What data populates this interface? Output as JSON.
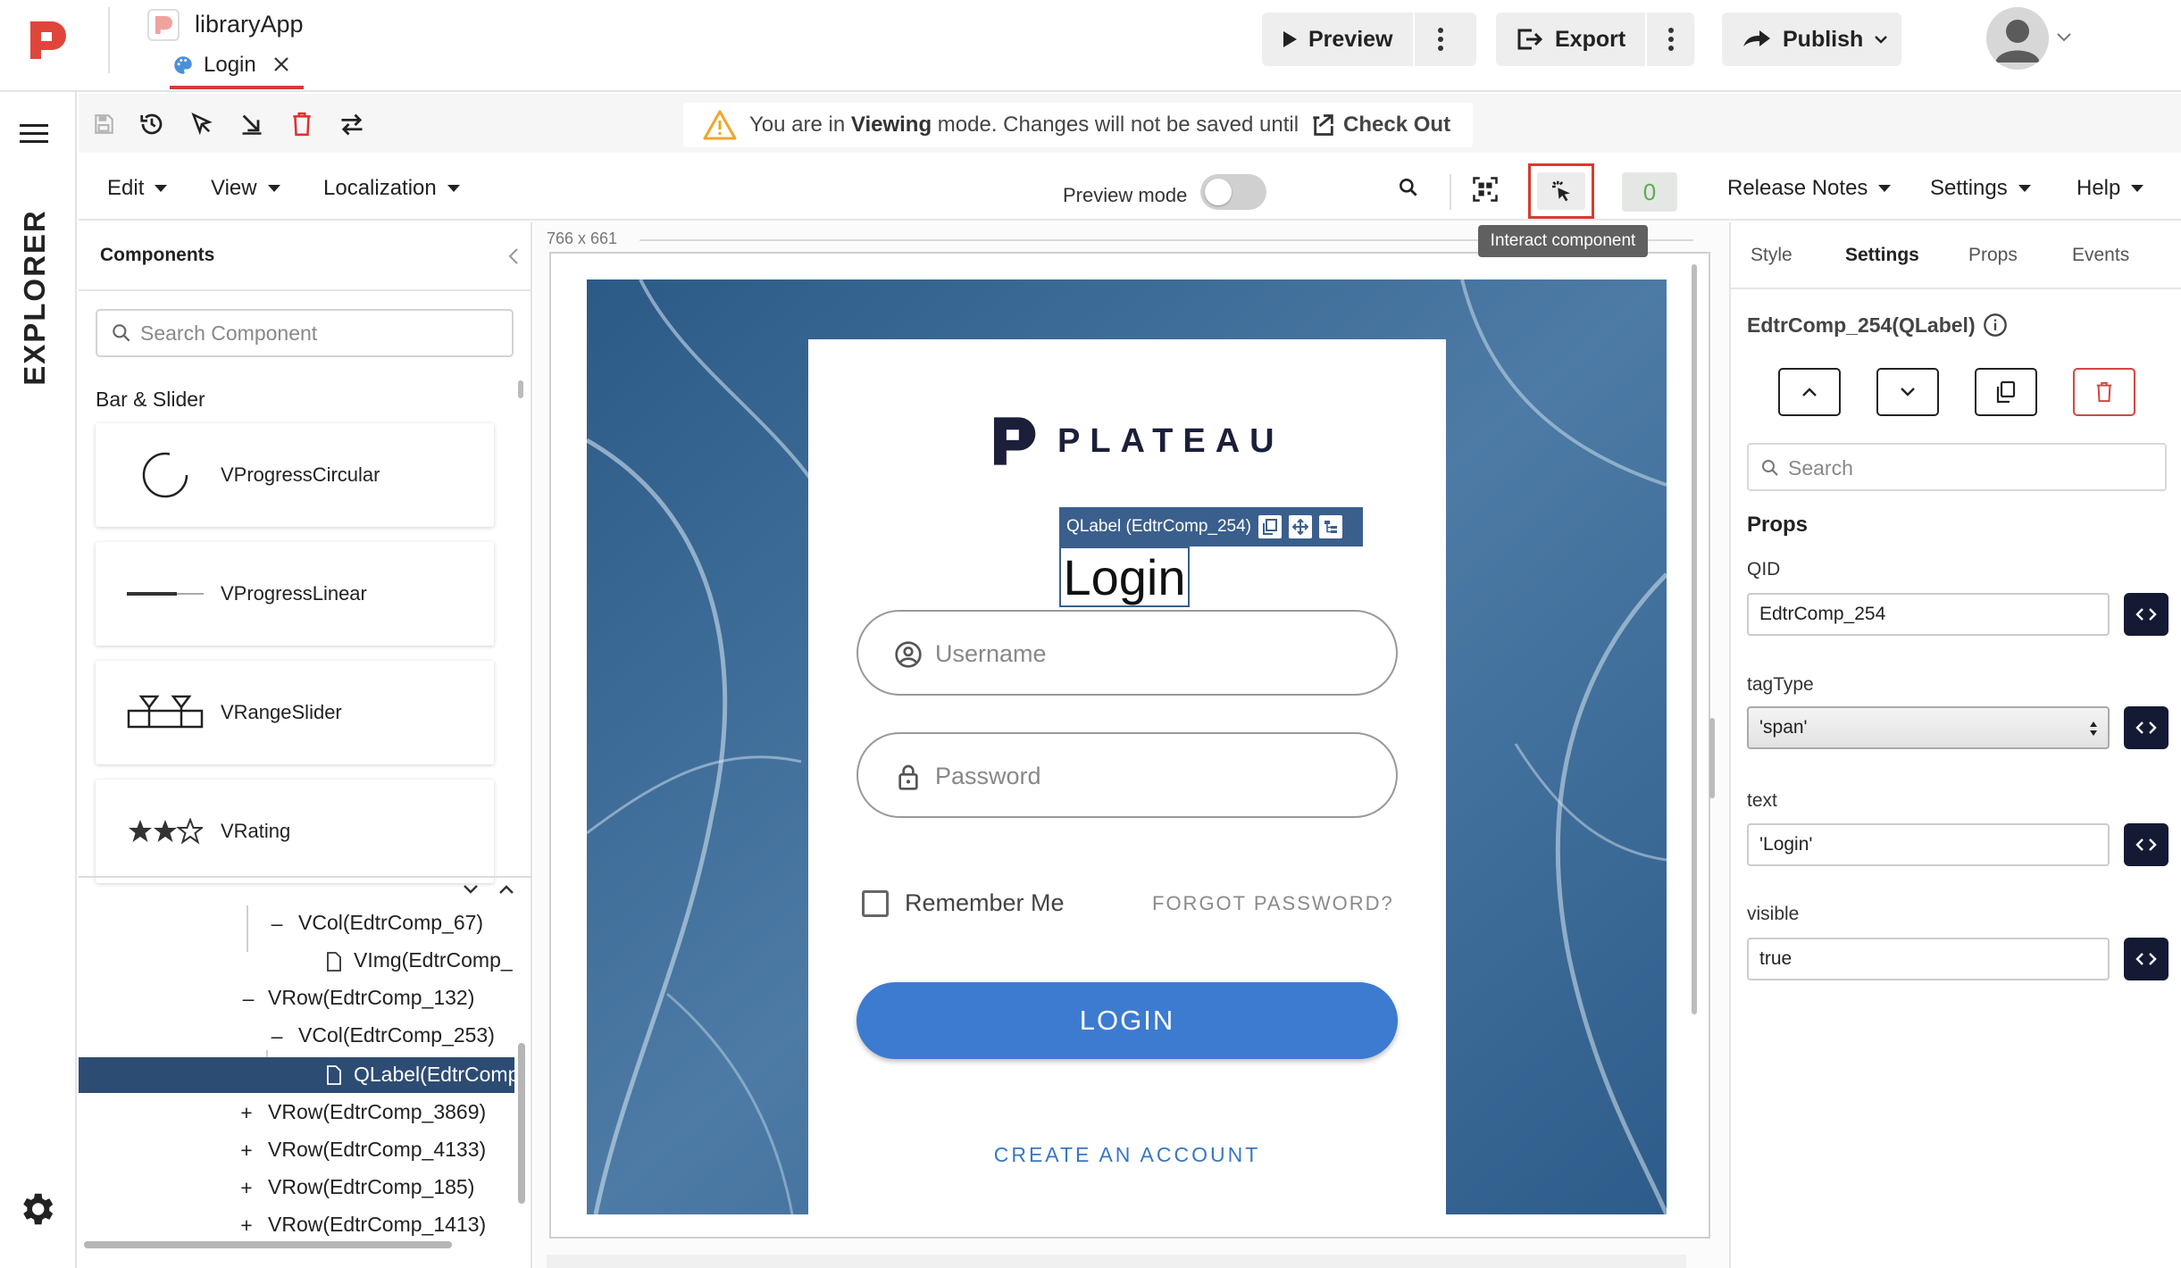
{
  "header": {
    "app_name": "libraryApp",
    "tab_label": "Login",
    "preview_label": "Preview",
    "export_label": "Export",
    "publish_label": "Publish"
  },
  "rail": {
    "label": "EXPLORER"
  },
  "notice": {
    "prefix": "You are in ",
    "mode": "Viewing",
    "suffix": " mode. Changes will not be saved until",
    "action": "Check Out"
  },
  "menus": {
    "edit": "Edit",
    "view": "View",
    "localization": "Localization",
    "preview_mode": "Preview mode",
    "release_notes": "Release Notes",
    "settings": "Settings",
    "help": "Help",
    "count": "0",
    "tooltip": "Interact component"
  },
  "components": {
    "title": "Components",
    "search_placeholder": "Search Component",
    "category": "Bar & Slider",
    "items": [
      {
        "label": "VProgressCircular",
        "icon": "progress-circular-icon"
      },
      {
        "label": "VProgressLinear",
        "icon": "progress-linear-icon"
      },
      {
        "label": "VRangeSlider",
        "icon": "range-slider-icon"
      },
      {
        "label": "VRating",
        "icon": "rating-icon"
      }
    ]
  },
  "tree": [
    {
      "sym": "–",
      "label": "VCol(EdtrComp_67)"
    },
    {
      "sym": "",
      "label": "VImg(EdtrComp_"
    },
    {
      "sym": "–",
      "label": "VRow(EdtrComp_132)"
    },
    {
      "sym": "–",
      "label": "VCol(EdtrComp_253)"
    },
    {
      "sym": "",
      "label": "QLabel(EdtrComp"
    },
    {
      "sym": "+",
      "label": "VRow(EdtrComp_3869)"
    },
    {
      "sym": "+",
      "label": "VRow(EdtrComp_4133)"
    },
    {
      "sym": "+",
      "label": "VRow(EdtrComp_185)"
    },
    {
      "sym": "+",
      "label": "VRow(EdtrComp_1413)"
    }
  ],
  "canvas": {
    "dimensions": "766 x 661",
    "brand": "PLATEAU",
    "selection_tag": "QLabel (EdtrComp_254)",
    "title": "Login",
    "username_placeholder": "Username",
    "password_placeholder": "Password",
    "remember_me": "Remember Me",
    "forgot_password": "FORGOT PASSWORD?",
    "login_button": "LOGIN",
    "create_account": "CREATE AN ACCOUNT"
  },
  "right_panel": {
    "tabs": [
      "Style",
      "Settings",
      "Props",
      "Events"
    ],
    "active_tab": "Settings",
    "component_title": "EdtrComp_254(QLabel)",
    "search_placeholder": "Search",
    "props_heading": "Props",
    "fields": [
      {
        "label": "QID",
        "value": "EdtrComp_254"
      },
      {
        "label": "tagType",
        "value": "'span'"
      },
      {
        "label": "text",
        "value": "'Login'"
      },
      {
        "label": "visible",
        "value": "true"
      }
    ]
  },
  "colors": {
    "accent": "#d63a3a",
    "selection": "#2d4c73",
    "login_button": "#3c7bd0",
    "code_button": "#141a33",
    "background_image": "#3b6691"
  }
}
